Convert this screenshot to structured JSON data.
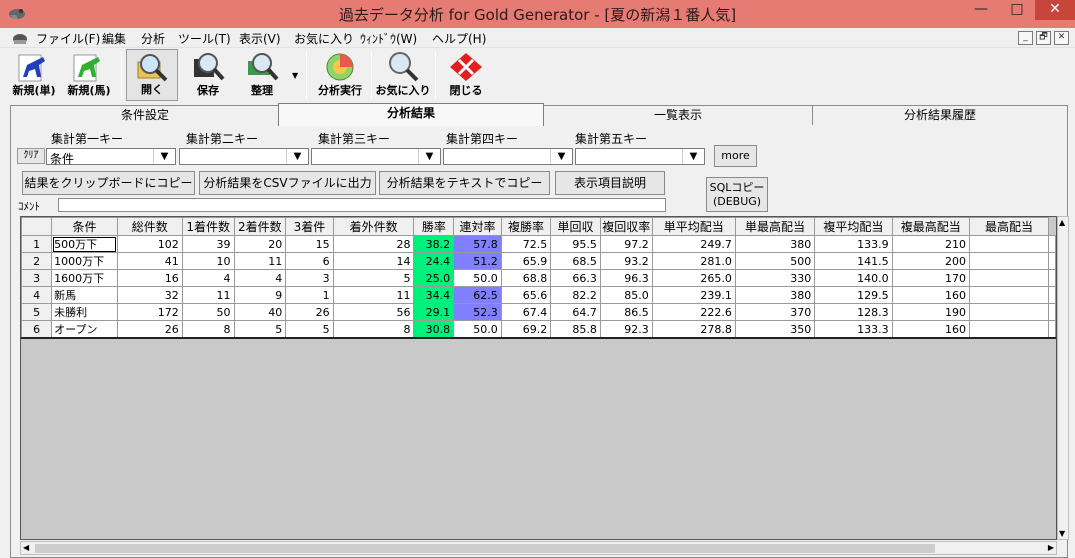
{
  "window": {
    "title": "過去データ分析 for Gold Generator - [夏の新潟１番人気]",
    "minimize": "—",
    "maximize": "□",
    "close": "✕"
  },
  "menu": {
    "items": [
      "ファイル(F)",
      "編集",
      "分析",
      "ツール(T)",
      "表示(V)",
      "お気に入り",
      "ｳｨﾝﾄﾞｳ(W)",
      "ヘルプ(H)"
    ],
    "mdi_buttons": [
      "_",
      "🗗",
      "✕"
    ]
  },
  "toolbar": {
    "new_single": "新規(単)",
    "new_horse": "新規(馬)",
    "open": "開く",
    "save": "保存",
    "organize": "整理",
    "run_analysis": "分析実行",
    "favorites": "お気に入り",
    "close": "閉じる"
  },
  "tabs": [
    "条件設定",
    "分析結果",
    "一覧表示",
    "分析結果履歴"
  ],
  "keys": {
    "labels": [
      "集計第一キー",
      "集計第二キー",
      "集計第三キー",
      "集計第四キー",
      "集計第五キー"
    ],
    "clear": "ｸﾘｱ",
    "values": [
      "条件",
      "",
      "",
      "",
      ""
    ],
    "more": "more"
  },
  "actions": {
    "copy_clipboard": "結果をクリップボードにコピー",
    "export_csv": "分析結果をCSVファイルに出力",
    "copy_text": "分析結果をテキストでコピー",
    "column_help": "表示項目説明",
    "sql_copy_line1": "SQLコピー",
    "sql_copy_line2": "(DEBUG)",
    "comment_label": "ｺﾒﾝﾄ",
    "comment_value": ""
  },
  "grid": {
    "columns": [
      "条件",
      "総件数",
      "1着件数",
      "2着件数",
      "3着件",
      "着外件数",
      "勝率",
      "連対率",
      "複勝率",
      "単回収",
      "複回収率",
      "単平均配当",
      "単最高配当",
      "複平均配当",
      "複最高配当",
      "最高配当"
    ],
    "rows": [
      {
        "no": "1",
        "cells": [
          "500万下",
          "102",
          "39",
          "20",
          "15",
          "28",
          "38.2",
          "57.8",
          "72.5",
          "95.5",
          "97.2",
          "249.7",
          "380",
          "133.9",
          "210",
          ""
        ],
        "win_hl": true,
        "ren_hl": true
      },
      {
        "no": "2",
        "cells": [
          "1000万下",
          "41",
          "10",
          "11",
          "6",
          "14",
          "24.4",
          "51.2",
          "65.9",
          "68.5",
          "93.2",
          "281.0",
          "500",
          "141.5",
          "200",
          ""
        ],
        "win_hl": true,
        "ren_hl": true
      },
      {
        "no": "3",
        "cells": [
          "1600万下",
          "16",
          "4",
          "4",
          "3",
          "5",
          "25.0",
          "50.0",
          "68.8",
          "66.3",
          "96.3",
          "265.0",
          "330",
          "140.0",
          "170",
          ""
        ],
        "win_hl": true,
        "ren_hl": false
      },
      {
        "no": "4",
        "cells": [
          "新馬",
          "32",
          "11",
          "9",
          "1",
          "11",
          "34.4",
          "62.5",
          "65.6",
          "82.2",
          "85.0",
          "239.1",
          "380",
          "129.5",
          "160",
          ""
        ],
        "win_hl": true,
        "ren_hl": true
      },
      {
        "no": "5",
        "cells": [
          "未勝利",
          "172",
          "50",
          "40",
          "26",
          "56",
          "29.1",
          "52.3",
          "67.4",
          "64.7",
          "86.5",
          "222.6",
          "370",
          "128.3",
          "190",
          ""
        ],
        "win_hl": true,
        "ren_hl": true
      },
      {
        "no": "6",
        "cells": [
          "オープン",
          "26",
          "8",
          "5",
          "5",
          "8",
          "30.8",
          "50.0",
          "69.2",
          "85.8",
          "92.3",
          "278.8",
          "350",
          "133.3",
          "160",
          ""
        ],
        "win_hl": true,
        "ren_hl": false
      }
    ]
  },
  "colors": {
    "titlebar": "#e67b74",
    "win_highlight": "#00f07c",
    "ren_highlight": "#8080ff"
  }
}
